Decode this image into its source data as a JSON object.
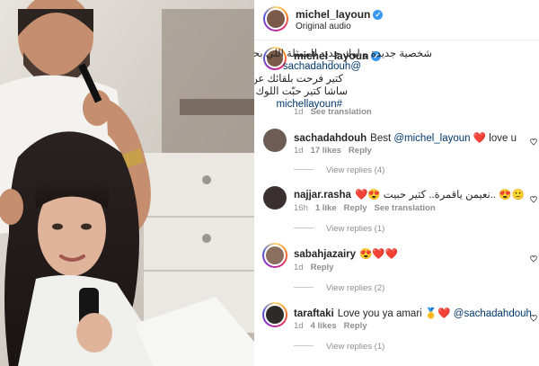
{
  "post": {
    "username": "michel_layoun",
    "audio": "Original audio"
  },
  "caption": {
    "username": "michel_layoun",
    "line1": "شخصية جديدة و لوك جديد للممثلة اللي بحبها كتير",
    "mention": "@sachadahdouh",
    "line3": "كتير فرحت بلقائك عن قرب ❤️",
    "line4": "ساشا كتير حبّت اللوك و انتو ؟؟!!! شو رايكم ؟؟!!!",
    "hashtag": "#michellayoun",
    "time": "1d",
    "translate": "See translation"
  },
  "comments": [
    {
      "username": "sachadahdouh",
      "text": "Best",
      "mention": "@michel_layoun",
      "tail": "❤️ love u",
      "time": "1d",
      "likes": "17 likes",
      "reply": "Reply",
      "translate": "",
      "view": "View replies (4)"
    },
    {
      "username": "najjar.rasha",
      "text": "❤️😍 نعيمن ياقمرة.. كتير حبيت.. 😍🙂",
      "mention": "",
      "tail": "",
      "time": "16h",
      "likes": "1 like",
      "reply": "Reply",
      "translate": "See translation",
      "view": "View replies (1)"
    },
    {
      "username": "sabahjazairy",
      "text": "😍❤️❤️",
      "mention": "",
      "tail": "",
      "time": "1d",
      "likes": "",
      "reply": "Reply",
      "translate": "",
      "view": "View replies (2)"
    },
    {
      "username": "taraftaki",
      "text": "Love you ya amari 🥇❤️",
      "mention": "@sachadahdouh",
      "tail": "",
      "time": "1d",
      "likes": "4 likes",
      "reply": "Reply",
      "translate": "",
      "view": "View replies (1)"
    }
  ],
  "colors": {
    "accent": "#3897f0",
    "link": "#00376b",
    "muted": "#8e8e8e",
    "heart": "#ed4956"
  }
}
